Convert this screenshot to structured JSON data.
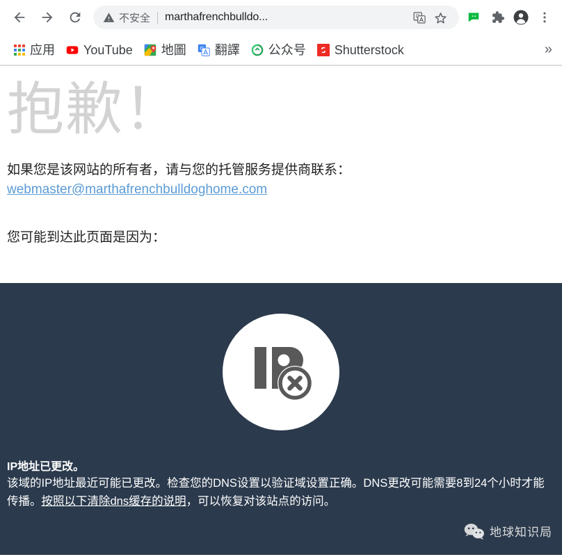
{
  "browser": {
    "nav": {
      "back_label": "Back",
      "forward_label": "Forward",
      "reload_label": "Reload"
    },
    "omnibox": {
      "security_label": "不安全",
      "security_icon": "warning-triangle-icon",
      "url": "marthafrenchbulldo...",
      "full_url": "marthafrenchbulldoghome.com",
      "translate_icon": "translate-icon",
      "bookmark_icon": "star-icon"
    },
    "toolbar_icons": [
      {
        "name": "wechat-extension-icon",
        "color": "#09b83e"
      },
      {
        "name": "extensions-puzzle-icon",
        "color": "#5f6368"
      },
      {
        "name": "profile-avatar-icon",
        "color": "#3c4043"
      },
      {
        "name": "more-menu-icon",
        "color": "#5f6368"
      }
    ],
    "bookmarks": [
      {
        "label": "应用",
        "icon": "apps-grid-icon"
      },
      {
        "label": "YouTube",
        "icon": "youtube-icon"
      },
      {
        "label": "地圖",
        "icon": "google-maps-icon"
      },
      {
        "label": "翻譯",
        "icon": "google-translate-icon"
      },
      {
        "label": "公众号",
        "icon": "wechat-official-icon"
      },
      {
        "label": "Shutterstock",
        "icon": "shutterstock-icon"
      }
    ],
    "bookmarks_overflow": "»"
  },
  "page": {
    "heading": "抱歉！",
    "owner_line": "如果您是该网站的所有者，请与您的托管服务提供商联系：",
    "email": "webmaster@marthafrenchbulldoghome.com",
    "reason_intro": "您可能到达此页面是因为：",
    "badge_icon": "ip-blocked-icon",
    "badge_letters": "IP",
    "error_title": "IP地址已更改。",
    "error_body_part1": "该域的IP地址最近可能已更改。检查您的DNS设置以验证域设置正确。DNS更改可能需要8到24个小时才能传播。",
    "error_body_link": "按照以下清除dns缓存的说明",
    "error_body_part2": "，可以恢复对该站点的访问。"
  },
  "watermark": {
    "text": "地球知识局",
    "icon": "wechat-logo-icon"
  },
  "colors": {
    "dark_panel": "#2b3a4d",
    "heading_gray": "#d3d3d3",
    "link_blue": "#5b9bd5",
    "chrome_bg": "#ffffff",
    "omnibox_bg": "#f1f3f4"
  }
}
